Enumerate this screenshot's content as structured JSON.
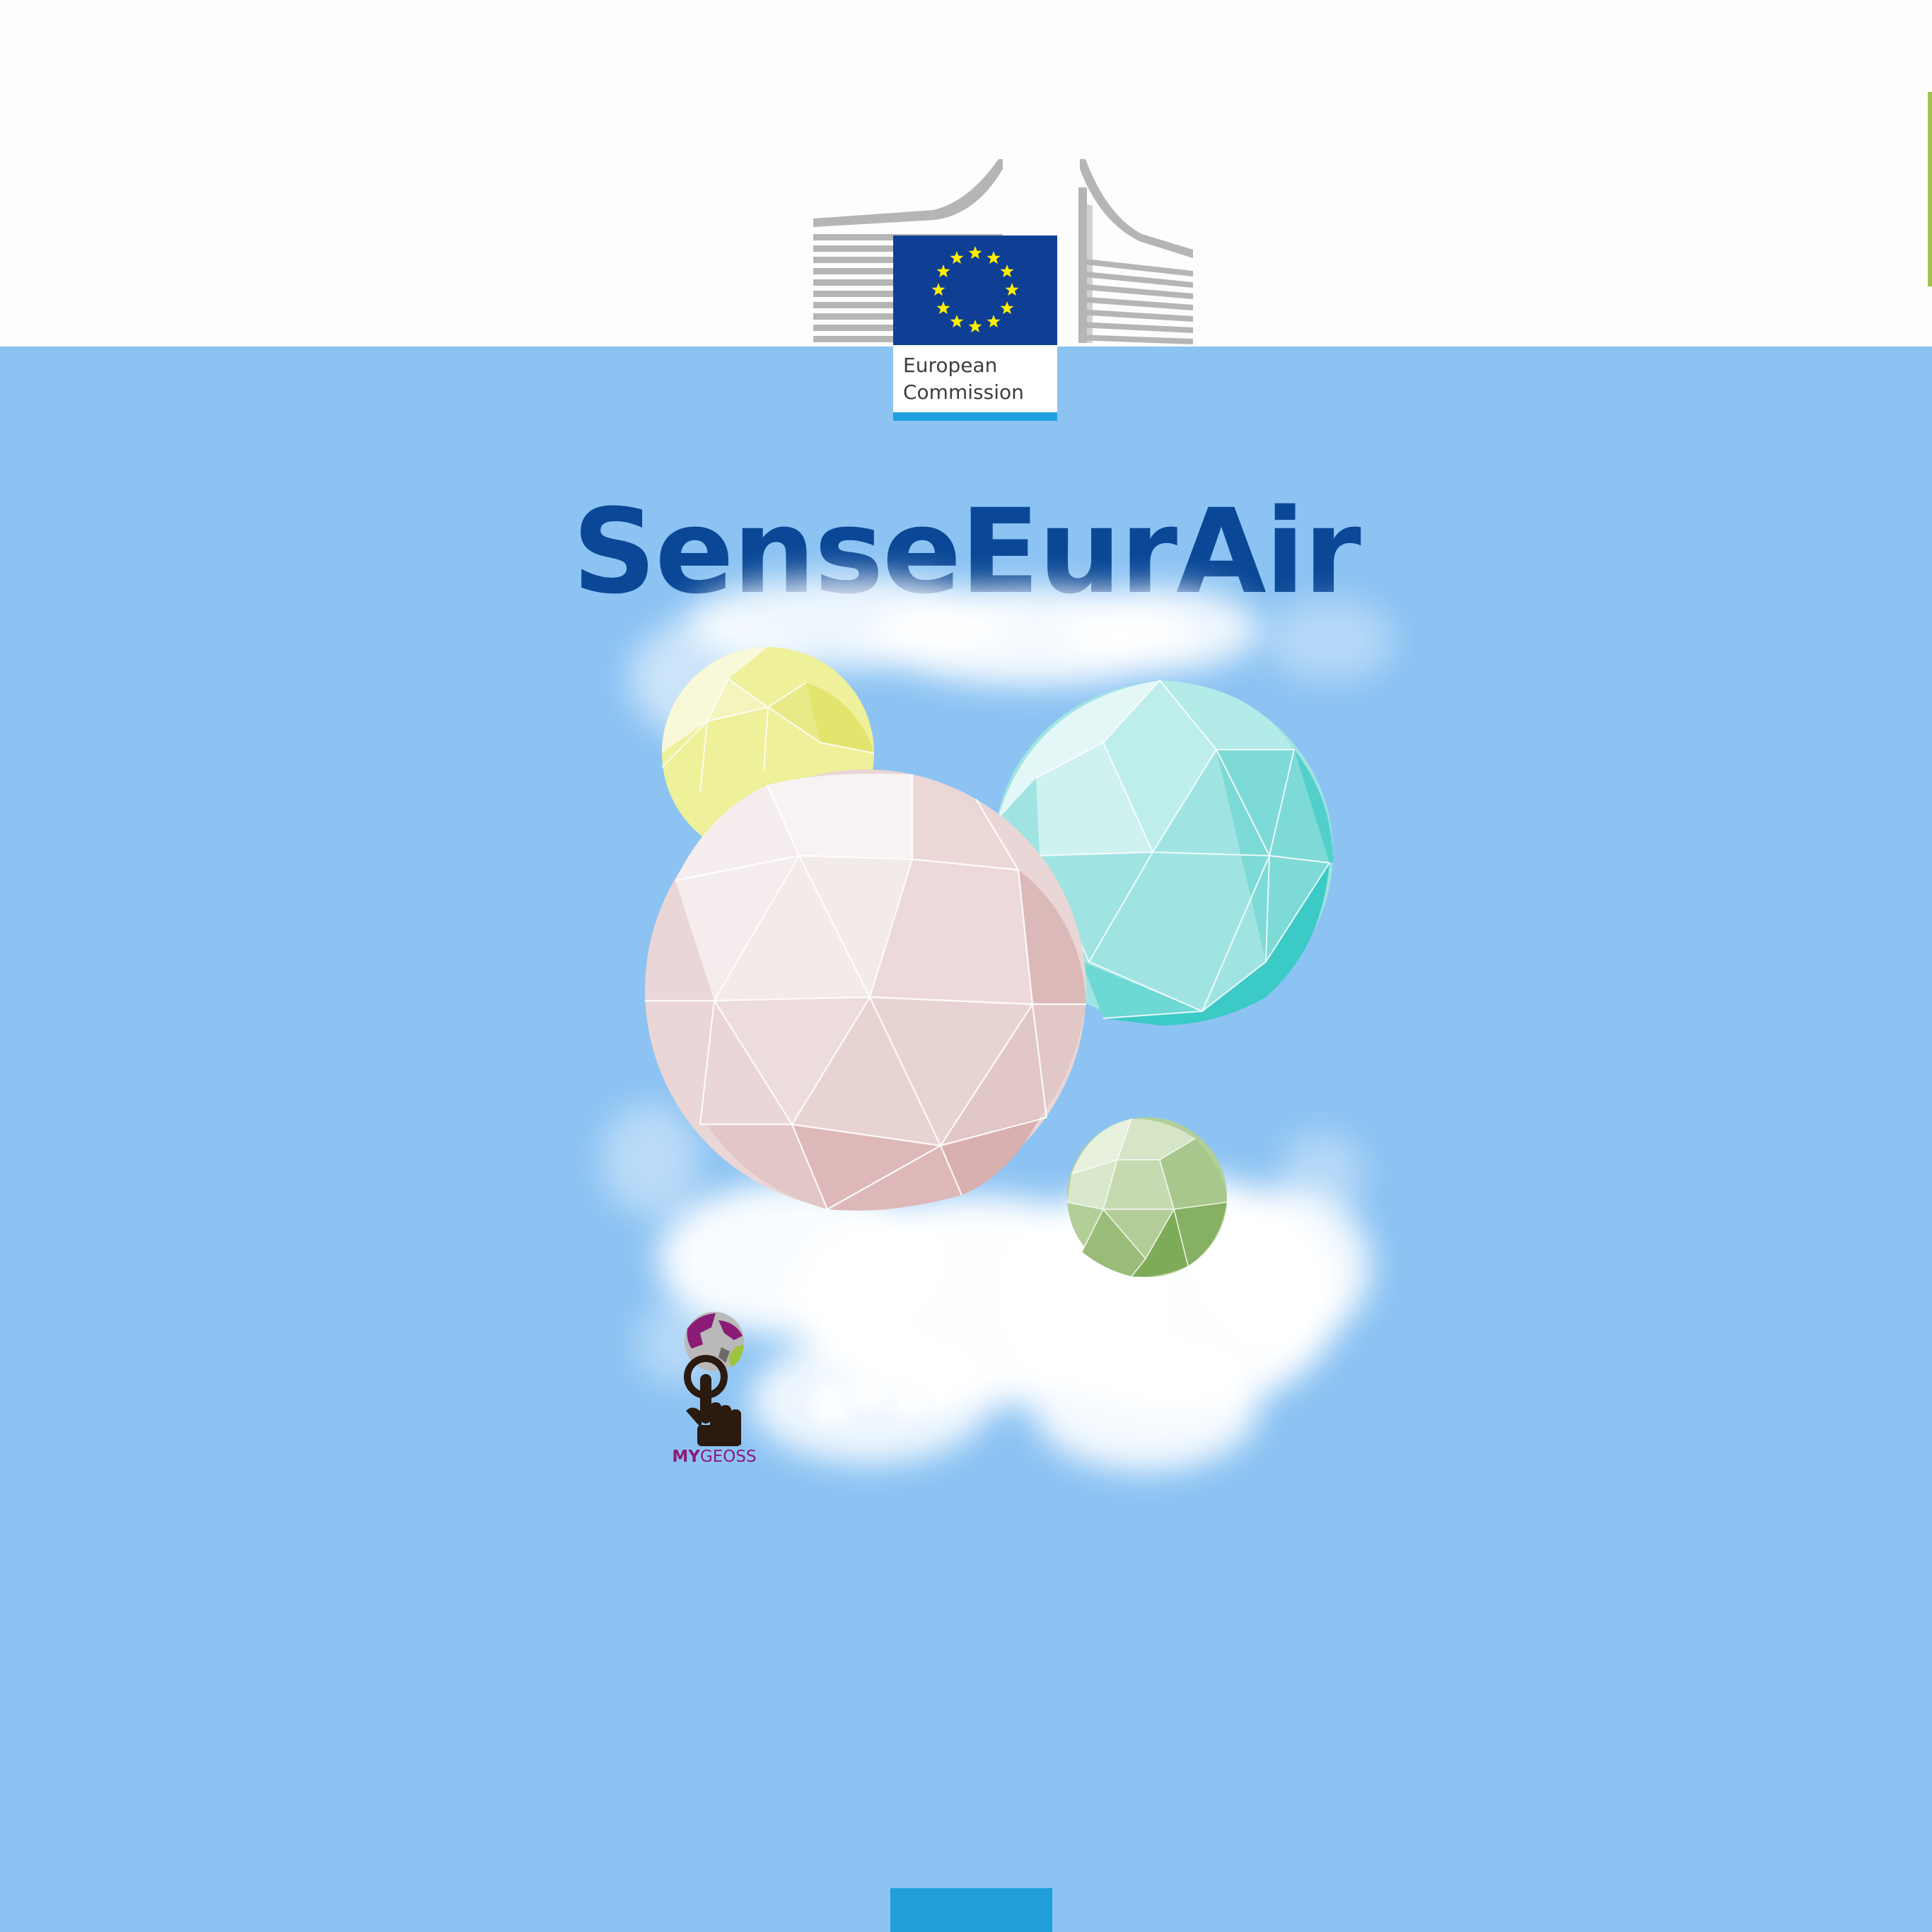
{
  "brand": {
    "logo_line1": "European",
    "logo_line2": "Commission",
    "flag_color": "#0e3f95",
    "star_color": "#ffed00",
    "accent_color": "#209fe0"
  },
  "app": {
    "title": "SenseEurAir",
    "title_color": "#0a4897",
    "background_color": "#8cc3f3"
  },
  "partner": {
    "label_my": "MY",
    "label_geoss": "GEOSS",
    "icon": "mygeoss-globe-hand-icon"
  },
  "illustration": {
    "spheres": [
      {
        "name": "yellow-sphere",
        "color": "#eef09a"
      },
      {
        "name": "pink-sphere",
        "color": "#ead6d6"
      },
      {
        "name": "teal-sphere",
        "color": "#9fe4e2"
      },
      {
        "name": "green-sphere",
        "color": "#b3cf98"
      }
    ],
    "clouds": "white-cloud-icon"
  }
}
